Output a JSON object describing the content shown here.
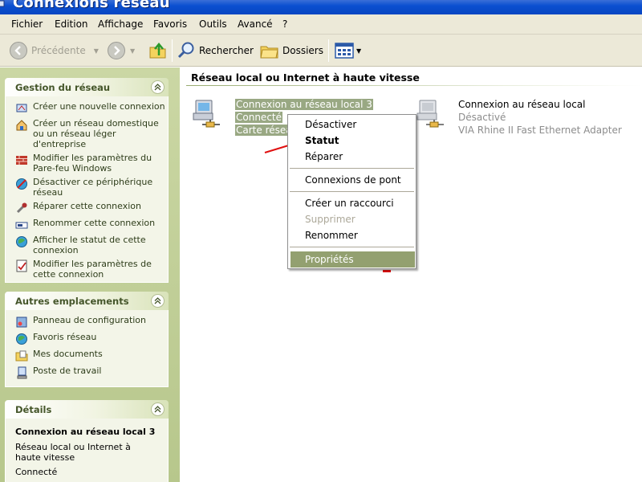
{
  "window": {
    "title": "Connexions réseau"
  },
  "menubar": [
    "Fichier",
    "Edition",
    "Affichage",
    "Favoris",
    "Outils",
    "Avancé",
    "?"
  ],
  "toolbar": {
    "back_label": "Précédente",
    "search_label": "Rechercher",
    "folders_label": "Dossiers"
  },
  "sidebar": {
    "network_tasks": {
      "title": "Gestion du réseau",
      "items": [
        {
          "label": "Créer une nouvelle connexion",
          "icon": "new-connection-icon"
        },
        {
          "label": "Créer un réseau domestique ou un réseau léger d'entreprise",
          "icon": "home-network-icon"
        },
        {
          "label": "Modifier les paramètres du Pare-feu Windows",
          "icon": "firewall-icon"
        },
        {
          "label": "Désactiver ce périphérique réseau",
          "icon": "disable-device-icon"
        },
        {
          "label": "Réparer cette connexion",
          "icon": "repair-icon"
        },
        {
          "label": "Renommer cette connexion",
          "icon": "rename-icon"
        },
        {
          "label": "Afficher le statut de cette connexion",
          "icon": "status-icon"
        },
        {
          "label": "Modifier les paramètres de cette connexion",
          "icon": "settings-icon"
        }
      ]
    },
    "other_places": {
      "title": "Autres emplacements",
      "items": [
        {
          "label": "Panneau de configuration",
          "icon": "control-panel-icon"
        },
        {
          "label": "Favoris réseau",
          "icon": "network-places-icon"
        },
        {
          "label": "Mes documents",
          "icon": "my-documents-icon"
        },
        {
          "label": "Poste de travail",
          "icon": "my-computer-icon"
        }
      ]
    },
    "details": {
      "title": "Détails",
      "name": "Connexion au réseau local 3",
      "type": "Réseau local ou Internet à haute vitesse",
      "status": "Connecté"
    }
  },
  "main": {
    "group_title": "Réseau local ou Internet à haute vitesse",
    "connections": [
      {
        "name": "Connexion au réseau local 3",
        "status": "Connecté",
        "device": "Carte résea"
      },
      {
        "name": "Connexion au réseau local",
        "status": "Désactivé",
        "device": "VIA Rhine II Fast Ethernet Adapter"
      }
    ]
  },
  "context_menu": {
    "items": [
      "Désactiver",
      "Statut",
      "Réparer",
      "Connexions de pont",
      "Créer un raccourci",
      "Supprimer",
      "Renommer",
      "Propriétés"
    ]
  },
  "colors": {
    "titlebar": "#0a4fd0",
    "sidebar": "#c1cf96",
    "selection": "#99a883",
    "menu_highlight": "#93a070",
    "arrow": "#e01010"
  }
}
